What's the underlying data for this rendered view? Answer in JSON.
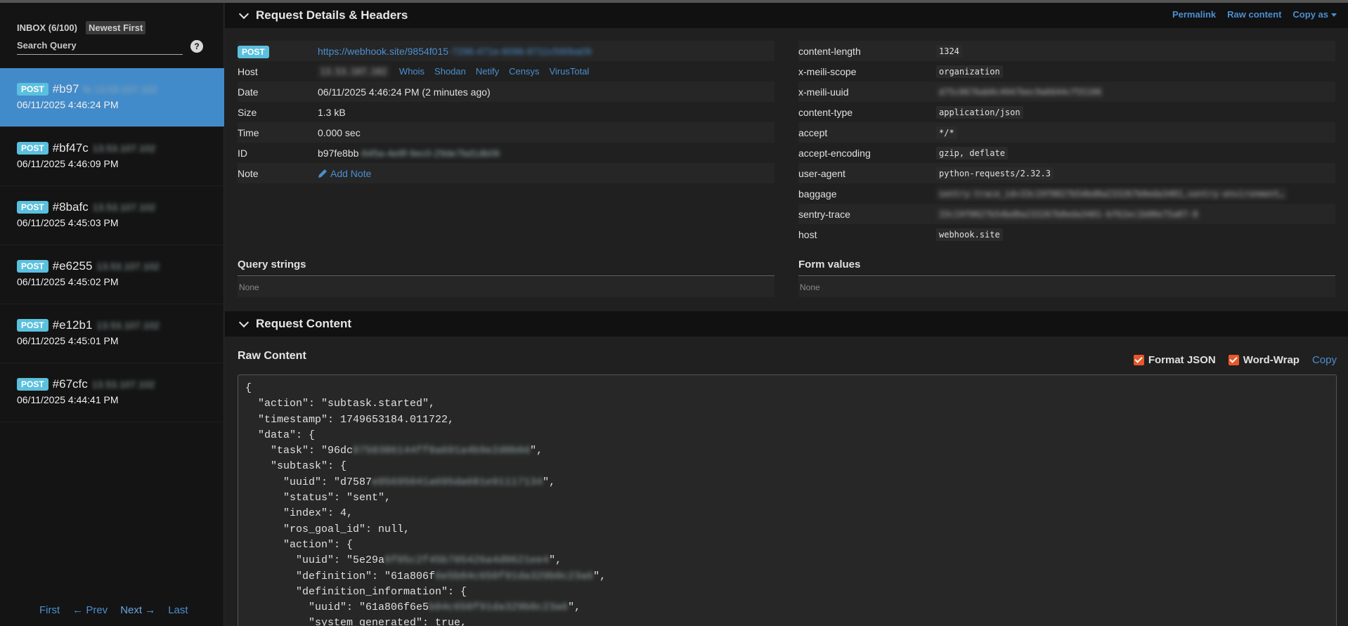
{
  "sidebar": {
    "inbox_label": "INBOX (6/100)",
    "sort_label": "Newest First",
    "search_placeholder": "Search Query",
    "help_symbol": "?",
    "requests": [
      {
        "method": "POST",
        "id": "#b97",
        "ip": "fe 13.53.107.102",
        "time": "06/11/2025 4:46:24 PM",
        "active": true
      },
      {
        "method": "POST",
        "id": "#bf47c",
        "ip": "13.53.107.102",
        "time": "06/11/2025 4:46:09 PM"
      },
      {
        "method": "POST",
        "id": "#8bafc",
        "ip": "13.53.107.102",
        "time": "06/11/2025 4:45:03 PM"
      },
      {
        "method": "POST",
        "id": "#e6255",
        "ip": "13.53.107.102",
        "time": "06/11/2025 4:45:02 PM"
      },
      {
        "method": "POST",
        "id": "#e12b1",
        "ip": "13.53.107.102",
        "time": "06/11/2025 4:45:01 PM"
      },
      {
        "method": "POST",
        "id": "#67cfc",
        "ip": "13.53.107.102",
        "time": "06/11/2025 4:44:41 PM"
      }
    ],
    "pager": {
      "first": "First",
      "prev": "← Prev",
      "next": "Next →",
      "last": "Last"
    }
  },
  "details_section": {
    "title": "Request Details & Headers",
    "actions": {
      "permalink": "Permalink",
      "raw": "Raw content",
      "copy": "Copy as"
    }
  },
  "details": {
    "method": "POST",
    "url_visible": "https://webhook.site/9854f015",
    "url_hidden": "-7296-471e-8096-8711c590ba09",
    "host_label": "Host",
    "host_ip": "13.53.107.102",
    "host_links": [
      "Whois",
      "Shodan",
      "Netify",
      "Censys",
      "VirusTotal"
    ],
    "date_label": "Date",
    "date": "06/11/2025 4:46:24 PM (2 minutes ago)",
    "size_label": "Size",
    "size": "1.3 kB",
    "time_label": "Time",
    "time": "0.000 sec",
    "id_label": "ID",
    "id_visible": "b97fe8bb",
    "id_hidden": "-645a-4e8f-9ec0-29de7bd1db06",
    "note_label": "Note",
    "add_note": "Add Note"
  },
  "headers": [
    {
      "key": "content-length",
      "value": "1324"
    },
    {
      "key": "x-meili-scope",
      "value": "organization"
    },
    {
      "key": "x-meili-uuid",
      "value": "d75c0676ab0c4947bec9a6644cf55106",
      "blurred": true
    },
    {
      "key": "content-type",
      "value": "application/json"
    },
    {
      "key": "accept",
      "value": "*/*"
    },
    {
      "key": "accept-encoding",
      "value": "gzip, deflate"
    },
    {
      "key": "user-agent",
      "value": "python-requests/2.32.3"
    },
    {
      "key": "baggage",
      "value": "sentry-trace_id=33c19f0027b54bd8a233267b0eda3401,sentry-environment…",
      "blurred": true
    },
    {
      "key": "sentry-trace",
      "value": "33c19f0027b54bd8a233267b0eda3401-bf62ec1b00e75a87-0",
      "blurred": true
    },
    {
      "key": "host",
      "value": "webhook.site"
    }
  ],
  "query_strings": {
    "title": "Query strings",
    "value": "None"
  },
  "form_values": {
    "title": "Form values",
    "value": "None"
  },
  "content_section": {
    "title": "Request Content",
    "raw_title": "Raw Content",
    "format_json": "Format JSON",
    "word_wrap": "Word-Wrap",
    "copy": "Copy"
  },
  "raw_lines": [
    {
      "text": "{"
    },
    {
      "text": "  \"action\": \"subtask.started\","
    },
    {
      "text": "  \"timestamp\": 1749653184.011722,"
    },
    {
      "text": "  \"data\": {"
    },
    {
      "text": "    \"task\": \"96dc",
      "hidden": "8750386144ff8a691a4b9e2d0b0d",
      "tail": "\","
    },
    {
      "text": "    \"subtask\": {"
    },
    {
      "text": "      \"uuid\": \"d7587",
      "hidden": "e05695041a695da681e91117134",
      "tail": "\","
    },
    {
      "text": "      \"status\": \"sent\","
    },
    {
      "text": "      \"index\": 4,"
    },
    {
      "text": "      \"ros_goal_id\": null,"
    },
    {
      "text": "      \"action\": {"
    },
    {
      "text": "        \"uuid\": \"5e29a",
      "hidden": "8f05c2f45b705426a4d0621ee4",
      "tail": "\","
    },
    {
      "text": "        \"definition\": \"61a806f",
      "hidden": "6e5b04c650f91da329b0c23a6",
      "tail": "\","
    },
    {
      "text": "        \"definition_information\": {"
    },
    {
      "text": "          \"uuid\": \"61a806f6e5",
      "hidden": "b04c650f91da329b0c23a6",
      "tail": "\","
    },
    {
      "text": "          \"system_generated\": true,"
    }
  ]
}
